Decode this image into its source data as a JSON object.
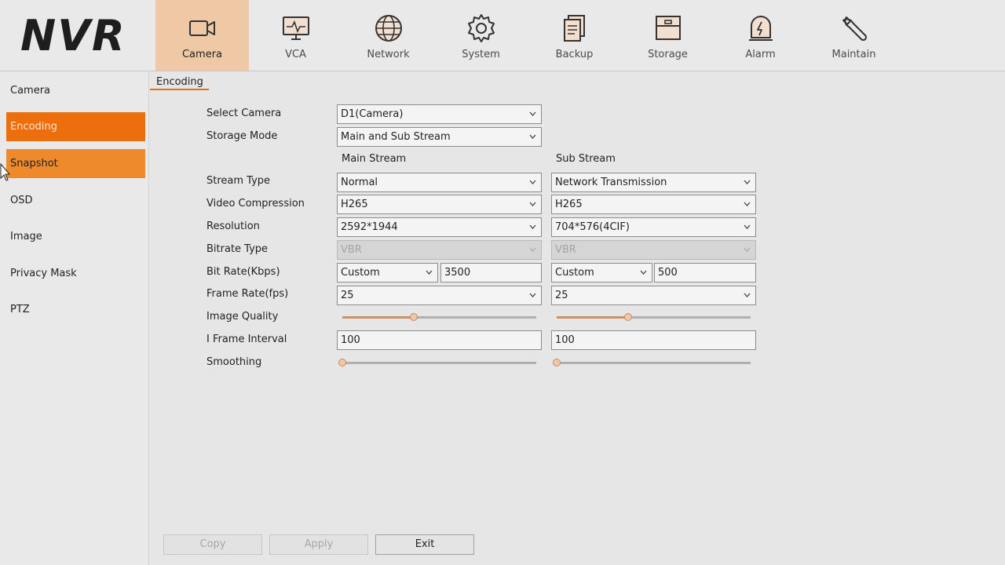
{
  "app": {
    "logo": "NVR"
  },
  "nav": [
    {
      "label": "Camera",
      "icon": "camera-icon"
    },
    {
      "label": "VCA",
      "icon": "monitor-wave-icon"
    },
    {
      "label": "Network",
      "icon": "globe-icon"
    },
    {
      "label": "System",
      "icon": "gear-icon"
    },
    {
      "label": "Backup",
      "icon": "documents-icon"
    },
    {
      "label": "Storage",
      "icon": "box-icon"
    },
    {
      "label": "Alarm",
      "icon": "alarm-bell-icon"
    },
    {
      "label": "Maintain",
      "icon": "wrench-icon"
    }
  ],
  "active_nav": "Camera",
  "sidebar": {
    "items": [
      {
        "label": "Camera"
      },
      {
        "label": "Encoding"
      },
      {
        "label": "Snapshot"
      },
      {
        "label": "OSD"
      },
      {
        "label": "Image"
      },
      {
        "label": "Privacy Mask"
      },
      {
        "label": "PTZ"
      }
    ],
    "active": "Encoding",
    "hovered": "Snapshot"
  },
  "tab": {
    "label": "Encoding"
  },
  "form": {
    "select_camera": {
      "label": "Select Camera",
      "value": "D1(Camera)"
    },
    "storage_mode": {
      "label": "Storage Mode",
      "value": "Main and Sub Stream"
    },
    "main_stream_head": "Main Stream",
    "sub_stream_head": "Sub Stream",
    "labels": {
      "stream_type": "Stream Type",
      "video_compression": "Video Compression",
      "resolution": "Resolution",
      "bitrate_type": "Bitrate Type",
      "bit_rate": "Bit Rate(Kbps)",
      "frame_rate": "Frame Rate(fps)",
      "image_quality": "Image Quality",
      "i_frame_interval": "I Frame Interval",
      "smoothing": "Smoothing"
    },
    "main": {
      "stream_type": "Normal",
      "video_compression": "H265",
      "resolution": "2592*1944",
      "bitrate_type": "VBR",
      "bit_rate_mode": "Custom",
      "bit_rate": "3500",
      "frame_rate": "25",
      "image_quality": 0.37,
      "i_frame_interval": "100",
      "smoothing": 0.0
    },
    "sub": {
      "stream_type": "Network Transmission",
      "video_compression": "H265",
      "resolution": "704*576(4CIF)",
      "bitrate_type": "VBR",
      "bit_rate_mode": "Custom",
      "bit_rate": "500",
      "frame_rate": "25",
      "image_quality": 0.37,
      "i_frame_interval": "100",
      "smoothing": 0.0
    }
  },
  "buttons": {
    "copy": "Copy",
    "apply": "Apply",
    "exit": "Exit"
  },
  "colors": {
    "accent": "#ec6e0c",
    "accent_light": "#ee8a2c",
    "nav_active_bg": "#efc9a6"
  }
}
